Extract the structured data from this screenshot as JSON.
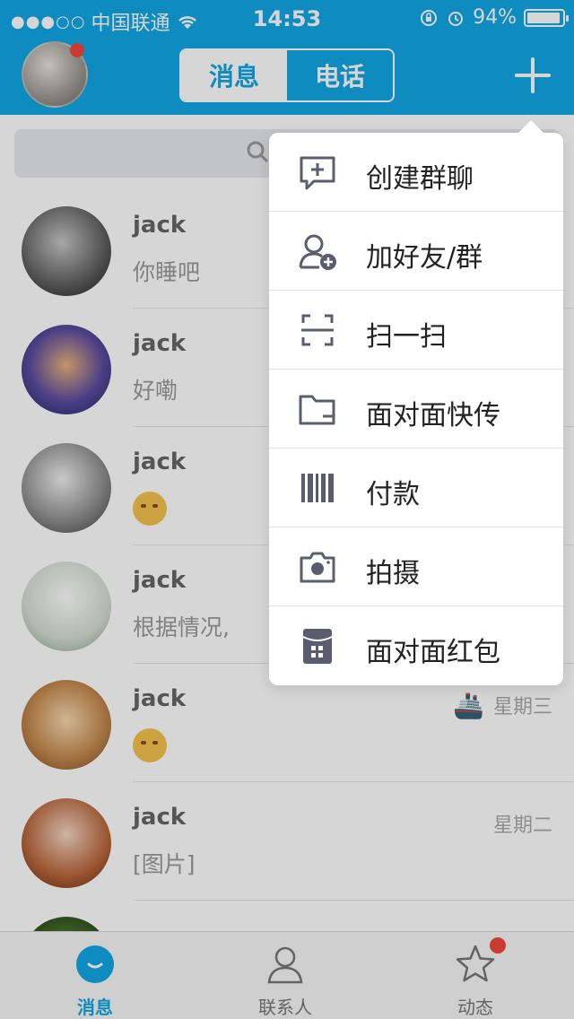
{
  "status_bar": {
    "signal": "●●●○○",
    "carrier": "中国联通",
    "time": "14:53",
    "battery_percent": "94%",
    "battery_level": 0.94
  },
  "header": {
    "seg_messages": "消息",
    "seg_calls": "电话"
  },
  "conversations": [
    {
      "name": "jack",
      "message": "你睡吧",
      "time": ""
    },
    {
      "name": "jack",
      "message": "好嘞",
      "time": ""
    },
    {
      "name": "jack",
      "message": "",
      "emoji": true,
      "time": ""
    },
    {
      "name": "jack",
      "message": "根据情况,",
      "time": ""
    },
    {
      "name": "jack",
      "message": "",
      "emoji": true,
      "time": "星期三",
      "ship": "🚢"
    },
    {
      "name": "jack",
      "message": "[图片]",
      "time": "星期二"
    }
  ],
  "menu": {
    "items": [
      {
        "label": "创建群聊",
        "icon": "create-group-chat-icon"
      },
      {
        "label": "加好友/群",
        "icon": "add-friend-icon"
      },
      {
        "label": "扫一扫",
        "icon": "scan-icon"
      },
      {
        "label": "面对面快传",
        "icon": "folder-transfer-icon"
      },
      {
        "label": "付款",
        "icon": "barcode-payment-icon"
      },
      {
        "label": "拍摄",
        "icon": "camera-icon"
      },
      {
        "label": "面对面红包",
        "icon": "red-packet-icon"
      }
    ]
  },
  "tabbar": {
    "messages": "消息",
    "contacts": "联系人",
    "moments": "动态"
  },
  "colors": {
    "accent": "#12a7e4",
    "badge": "#f0473a",
    "menu_icon": "#5a5d70"
  }
}
